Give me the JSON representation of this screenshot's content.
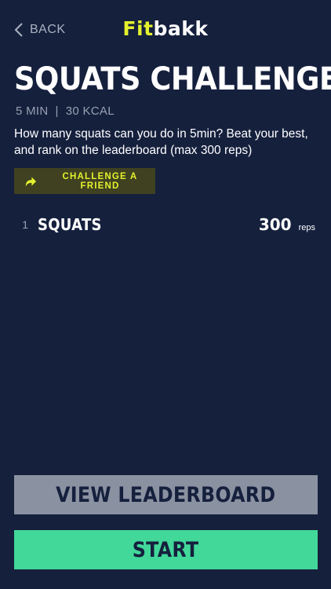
{
  "header": {
    "back_label": "BACK",
    "logo_part1": "Fit",
    "logo_part2": "bakk"
  },
  "challenge": {
    "title": "SQUATS CHALLENGE",
    "duration": "5 MIN",
    "separator": "|",
    "calories": "30 KCAL",
    "description": "How many squats can you do in 5min? Beat your best, and rank on the leaderboard (max 300 reps)",
    "challenge_friend_label": "CHALLENGE A FRIEND"
  },
  "exercises": [
    {
      "index": "1",
      "name": "SQUATS",
      "reps": "300",
      "unit": "reps"
    }
  ],
  "actions": {
    "leaderboard_label": "VIEW LEADERBOARD",
    "start_label": "START"
  },
  "colors": {
    "background": "#15203d",
    "accent_yellow": "#e4f12d",
    "start_green": "#41d89a",
    "leaderboard_gray": "#8a91a1"
  }
}
